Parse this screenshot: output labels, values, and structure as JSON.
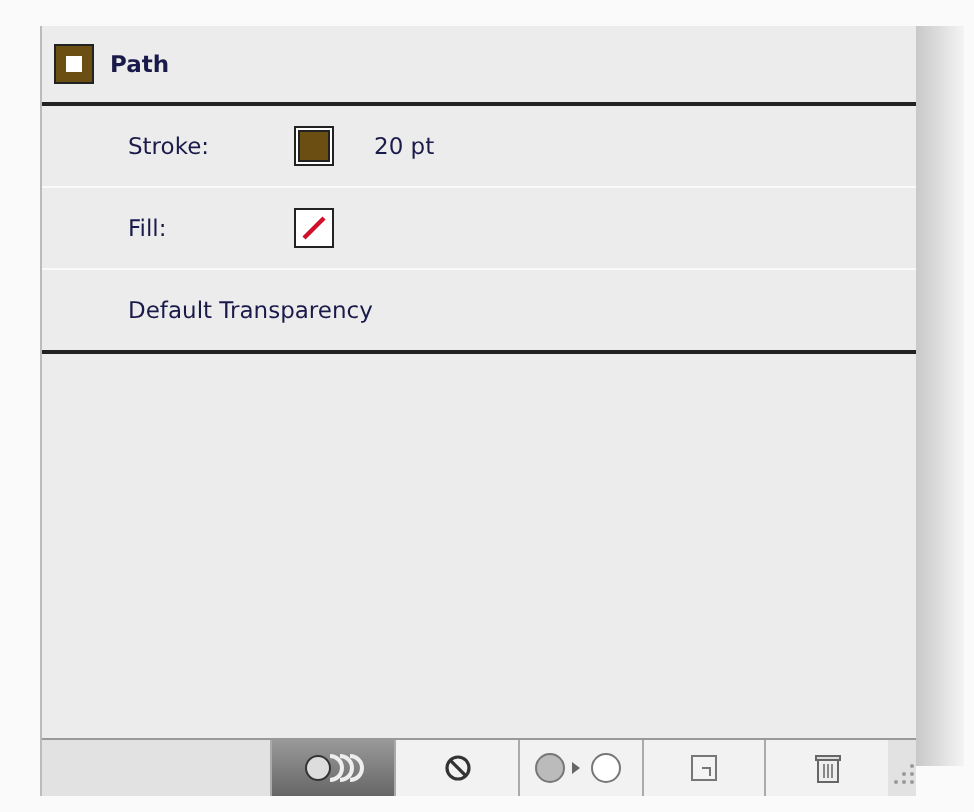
{
  "item": {
    "title": "Path"
  },
  "attributes": [
    {
      "kind": "swatch",
      "label": "Stroke:",
      "color": "#6b4f12",
      "value": "20 pt"
    },
    {
      "kind": "none",
      "label": "Fill:"
    },
    {
      "kind": "plain",
      "label": "Default Transparency"
    }
  ],
  "toolbar": [
    {
      "kind": "effects",
      "selected": true
    },
    {
      "kind": "clear",
      "selected": false
    },
    {
      "kind": "reduce",
      "selected": false
    },
    {
      "kind": "duplicate",
      "selected": false
    },
    {
      "kind": "delete",
      "selected": false
    }
  ]
}
